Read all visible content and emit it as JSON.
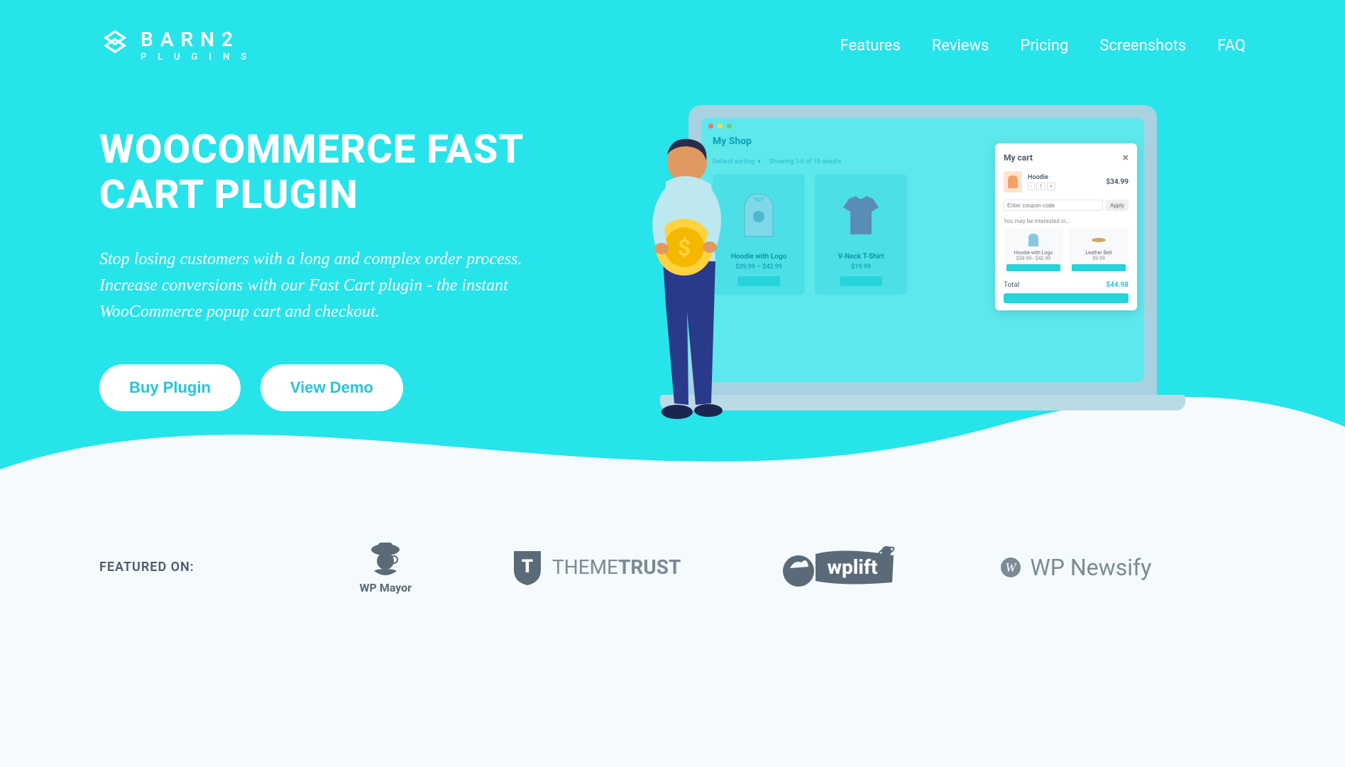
{
  "brand": {
    "title": "BARN2",
    "subtitle": "PLUGINS"
  },
  "nav": {
    "features": "Features",
    "reviews": "Reviews",
    "pricing": "Pricing",
    "screenshots": "Screenshots",
    "faq": "FAQ"
  },
  "hero": {
    "title": "WOOCOMMERCE FAST CART PLUGIN",
    "description": "Stop losing customers with a long and complex order process. Increase conversions with our Fast Cart plugin - the instant WooCommerce popup cart and checkout.",
    "buy_label": "Buy Plugin",
    "demo_label": "View Demo"
  },
  "mock": {
    "shop_title": "My Shop",
    "sort_label": "Default sorting",
    "results_label": "Showing 1-6 of 18 results",
    "product1_name": "Hoodie with Logo",
    "product1_price": "$39.99 – $42.99",
    "product2_name": "V-Neck T-Shirt",
    "product2_price": "$19.99",
    "cart_title": "My cart",
    "cart_item_name": "Hoodie",
    "cart_item_price": "$34.99",
    "coupon_placeholder": "Enter coupon code",
    "apply_label": "Apply",
    "suggest_label": "You may be interested in…",
    "sugg1_name": "Hoodie with Logo",
    "sugg1_price": "$39.99 - $42.99",
    "sugg2_name": "Leather Belt",
    "sugg2_price": "$9.99",
    "total_label": "Total",
    "total_value": "$44.98"
  },
  "featured": {
    "label": "FEATURED ON:",
    "wpmayor": "WP Mayor",
    "themetrust_a": "THEME",
    "themetrust_b": "TRUST",
    "wplift": "wplift",
    "wpnewsify": "WP Newsify"
  }
}
